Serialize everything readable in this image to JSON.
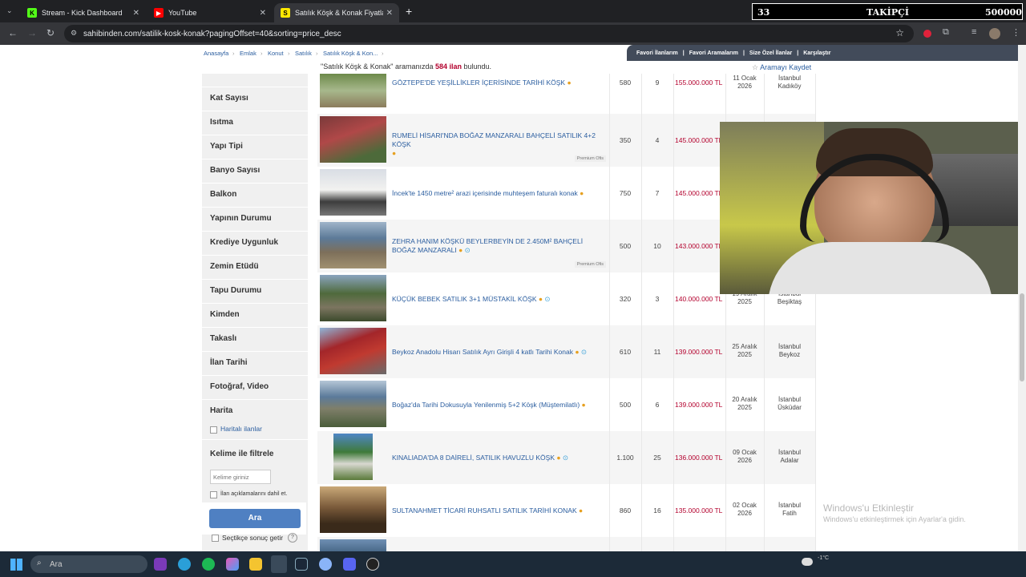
{
  "tabs": [
    {
      "label": "Stream - Kick Dashboard",
      "icon": "kick-icon"
    },
    {
      "label": "YouTube",
      "icon": "youtube-icon"
    },
    {
      "label": "Satılık Köşk & Konak Fiyatları s...",
      "icon": "sahibinden-icon"
    }
  ],
  "address": {
    "url": "sahibinden.com/satilik-kosk-konak?pagingOffset=40&sorting=price_desc"
  },
  "overlay": {
    "left": "33",
    "center": "TAKİPÇİ",
    "right": "500000"
  },
  "breadcrumb": [
    "Anasayfa",
    "Emlak",
    "Konut",
    "Satılık",
    "Satılık Köşk & Kon..."
  ],
  "favbar": [
    "Favori İlanlarım",
    "Favori Aramalarım",
    "Size Özel İlanlar",
    "Karşılaştır"
  ],
  "results": {
    "query": "\"Satılık Köşk & Konak\"",
    "mid": " aramanızda ",
    "count": "584 ilan",
    "end": " bulundu."
  },
  "save_search": "Aramayı Kaydet",
  "filters": [
    "Kat Sayısı",
    "Isıtma",
    "Yapı Tipi",
    "Banyo Sayısı",
    "Balkon",
    "Yapının Durumu",
    "Krediye Uygunluk",
    "Zemin Etüdü",
    "Tapu Durumu",
    "Kimden",
    "Takaslı",
    "İlan Tarihi",
    "Fotoğraf, Video",
    "Harita"
  ],
  "map_listings": "Haritalı ilanlar",
  "keyword_filter": {
    "title": "Kelime ile filtrele",
    "placeholder": "Kelime giriniz",
    "include_desc": "İlan açıklamalarını dahil et."
  },
  "search_button": "Ara",
  "select_checkbox": "Seçtikçe sonuç getir",
  "listings": [
    {
      "title": "GÖZTEPE'DE YEŞİLLİKLER İÇERİSİNDE TARİHİ KÖŞK",
      "m2": "580",
      "rooms": "9",
      "price": "155.000.000 TL",
      "date1": "11 Ocak",
      "date2": "2026",
      "loc1": "İstanbul",
      "loc2": "Kadıköy",
      "badge": ""
    },
    {
      "title": "RUMELİ HİSARI'NDA BOĞAZ MANZARALI BAHÇELİ SATILIK 4+2 KÖŞK",
      "m2": "350",
      "rooms": "4",
      "price": "145.000.000 TL",
      "date1": "",
      "date2": "",
      "loc1": "",
      "loc2": "",
      "badge": "Premium Ofis"
    },
    {
      "title": "İncek'te 1450 metre² arazi içerisinde muhteşem faturalı konak",
      "m2": "750",
      "rooms": "7",
      "price": "145.000.000 TL",
      "date1": "",
      "date2": "",
      "loc1": "",
      "loc2": "",
      "badge": ""
    },
    {
      "title": "ZEHRA HANIM KÖŞKÜ BEYLERBEYİN DE 2.450M² BAHÇELİ BOĞAZ MANZARALI",
      "m2": "500",
      "rooms": "10",
      "price": "143.000.000 TL",
      "date1": "",
      "date2": "",
      "loc1": "",
      "loc2": "",
      "badge": "Premium Ofis"
    },
    {
      "title": "KÜÇÜK BEBEK SATILIK 3+1 MÜSTAKİL KÖŞK",
      "m2": "320",
      "rooms": "3",
      "price": "140.000.000 TL",
      "date1": "19 Aralık",
      "date2": "2025",
      "loc1": "İstanbul",
      "loc2": "Beşiktaş",
      "badge": ""
    },
    {
      "title": "Beykoz Anadolu Hisarı Satılık Ayrı Girişli 4 katlı Tarihi Konak",
      "m2": "610",
      "rooms": "11",
      "price": "139.000.000 TL",
      "date1": "25 Aralık",
      "date2": "2025",
      "loc1": "İstanbul",
      "loc2": "Beykoz",
      "badge": ""
    },
    {
      "title": "Boğaz'da Tarihi Dokusuyla Yenilenmiş 5+2 Köşk (Müştemilatlı)",
      "m2": "500",
      "rooms": "6",
      "price": "139.000.000 TL",
      "date1": "20 Aralık",
      "date2": "2025",
      "loc1": "İstanbul",
      "loc2": "Üsküdar",
      "badge": ""
    },
    {
      "title": "KINALIADA'DA 8 DAİRELİ, SATILIK HAVUZLU KÖŞK",
      "m2": "1.100",
      "rooms": "25",
      "price": "136.000.000 TL",
      "date1": "09 Ocak",
      "date2": "2026",
      "loc1": "İstanbul",
      "loc2": "Adalar",
      "badge": ""
    },
    {
      "title": "SULTANAHMET TİCARİ RUHSATLI SATILIK TARİHİ KONAK",
      "m2": "860",
      "rooms": "16",
      "price": "135.000.000 TL",
      "date1": "02 Ocak",
      "date2": "2026",
      "loc1": "İstanbul",
      "loc2": "Fatih",
      "badge": ""
    }
  ],
  "watermark": {
    "title": "Windows'u Etkinleştir",
    "sub": "Windows'u etkinleştirmek için Ayarlar'a gidin."
  },
  "taskbar": {
    "search": "Ara",
    "weather": "-1°C"
  }
}
